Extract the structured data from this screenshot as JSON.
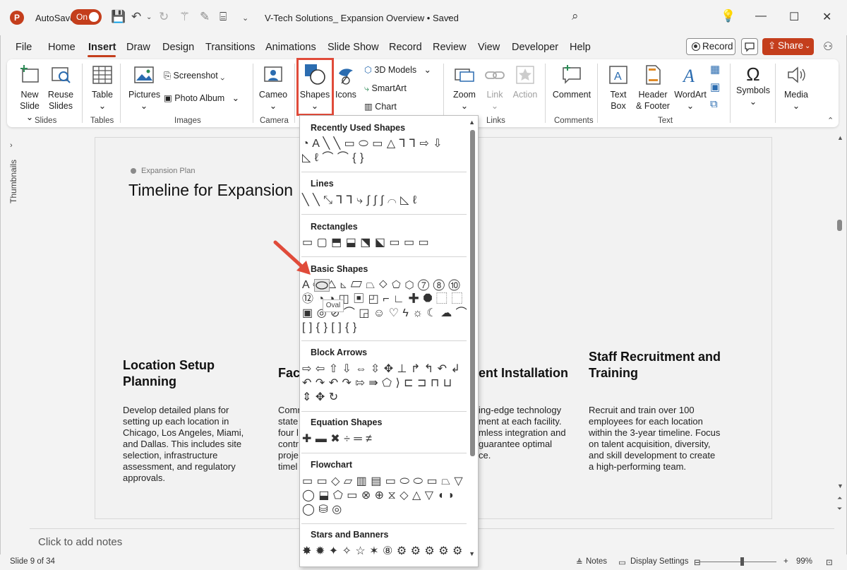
{
  "titlebar": {
    "autosave_label": "AutoSave",
    "autosave_state": "On",
    "doc_title": "V-Tech Solutions_ Expansion Overview • Saved"
  },
  "tabs": [
    "File",
    "Home",
    "Insert",
    "Draw",
    "Design",
    "Transitions",
    "Animations",
    "Slide Show",
    "Record",
    "Review",
    "View",
    "Developer",
    "Help"
  ],
  "active_tab": "Insert",
  "toolbar_right": {
    "record": "Record",
    "share": "Share"
  },
  "ribbon": {
    "new_slide": [
      "New",
      "Slide"
    ],
    "reuse_slides": [
      "Reuse",
      "Slides"
    ],
    "table": "Table",
    "pictures": "Pictures",
    "screenshot": "Screenshot",
    "photo_album": "Photo Album",
    "cameo": "Cameo",
    "shapes": "Shapes",
    "icons": "Icons",
    "models3d": "3D Models",
    "smartart": "SmartArt",
    "chart": "Chart",
    "zoom": "Zoom",
    "link": "Link",
    "action": "Action",
    "comment": "Comment",
    "text_box": [
      "Text",
      "Box"
    ],
    "header_footer": [
      "Header",
      "& Footer"
    ],
    "wordart": "WordArt",
    "symbols": "Symbols",
    "media": "Media",
    "groups": {
      "slides": "Slides",
      "tables": "Tables",
      "images": "Images",
      "camera": "Camera",
      "links": "Links",
      "comments": "Comments",
      "text": "Text"
    }
  },
  "rail": {
    "label": "Thumbnails"
  },
  "slide": {
    "badge": "Expansion Plan",
    "title": "Timeline for Expansion",
    "col1_head": [
      "Location Setup",
      "Planning"
    ],
    "col1_body": [
      "Develop detailed plans for",
      "setting up each location in",
      "Chicago, Los Angeles, Miami,",
      "and Dallas. This includes site",
      "selection, infrastructure",
      "assessment, and regulatory",
      "approvals."
    ],
    "col2_head": "Fac",
    "col2_body": [
      "Comm",
      "state",
      "four l",
      "contr",
      "proje",
      "timel"
    ],
    "col3_head": "ent Installation",
    "col3_body": [
      "ing-edge technology",
      "ment at each facility.",
      "mless integration and",
      "guarantee optimal",
      "ce."
    ],
    "col4_head": [
      "Staff Recruitment and",
      "Training"
    ],
    "col4_body": [
      "Recruit and train over 100",
      "employees for each location",
      "within the 3-year timeline. Focus",
      "on talent acquisition, diversity,",
      "and skill development to create",
      "a high-performing team."
    ]
  },
  "gallery": {
    "sections": [
      "Recently Used Shapes",
      "Lines",
      "Rectangles",
      "Basic Shapes",
      "Block Arrows",
      "Equation Shapes",
      "Flowchart",
      "Stars and Banners"
    ],
    "recent_row1": "◔ A ╲ ╲ ▭ ⬭ ▭ △ ⅂ ⅂ ⇨ ⇩",
    "recent_row2": "◺ ℓ ⌒ ⌒ { }",
    "lines_row": "╲ ╲ ⤡ ⅂ ⅂ ⤷ ∫ ∫ ∫ ⌒ ◺ ℓ",
    "rect_row": "▭ ▢ ⬒ ⬓ ⬔ ⬕ ▭ ▭ ▭",
    "basic_row1": "A ⬭ △ ◺ ▱ ⏢ ◇ ⬠ ⬡ ⑦ ⑧ ⑩",
    "basic_row2": "⑫ ◔ ◑ ◫ ▣ ◰ ⌐ ∟ ✚ ⯃ ⬚ ⬚",
    "basic_row3": "▣ ◎ ⊘ ⌒ ◲ ☺ ♡ ϟ ☼ ☾ ☁ ⌒",
    "basic_row4": "[ ] { } [ ] { }",
    "arrows_row1": "⇨ ⇦ ⇧ ⇩ ⇔ ⇳ ✥ ⊥ ↱ ↰ ↶ ↲",
    "arrows_row2": "↶ ↷ ↶ ↷ ⇰ ⇛ ⬠ ⟩ ⊏ ⊐ ⊓ ⊔",
    "arrows_row3": "⇕ ✥ ↻",
    "equation_row": "✚ ▬ ✖ ÷ ═ ≠",
    "flow_row1": "▭ ▭ ◇ ▱ ▥ ▤ ▭ ⬭ ⬭ ▭ ⏢ ▽",
    "flow_row2": "◯ ⬓ ⬠ ▭ ⊗ ⊕ ⧖ ◇ △ ▽ ◖ ◗",
    "flow_row3": "◯ ⛁ ◎",
    "stars_row": "✸ ✹ ✦ ✧ ☆ ✶ ⑧ ⚙ ⚙ ⚙ ⚙ ⚙",
    "tooltip": "Oval"
  },
  "notes": {
    "placeholder": "Click to add notes"
  },
  "status": {
    "slide_info": "Slide 9 of 34",
    "notes": "Notes",
    "display_settings": "Display Settings",
    "zoom": "99%"
  },
  "colors": {
    "accent": "#c43e1c",
    "callout": "#e04b3a"
  }
}
